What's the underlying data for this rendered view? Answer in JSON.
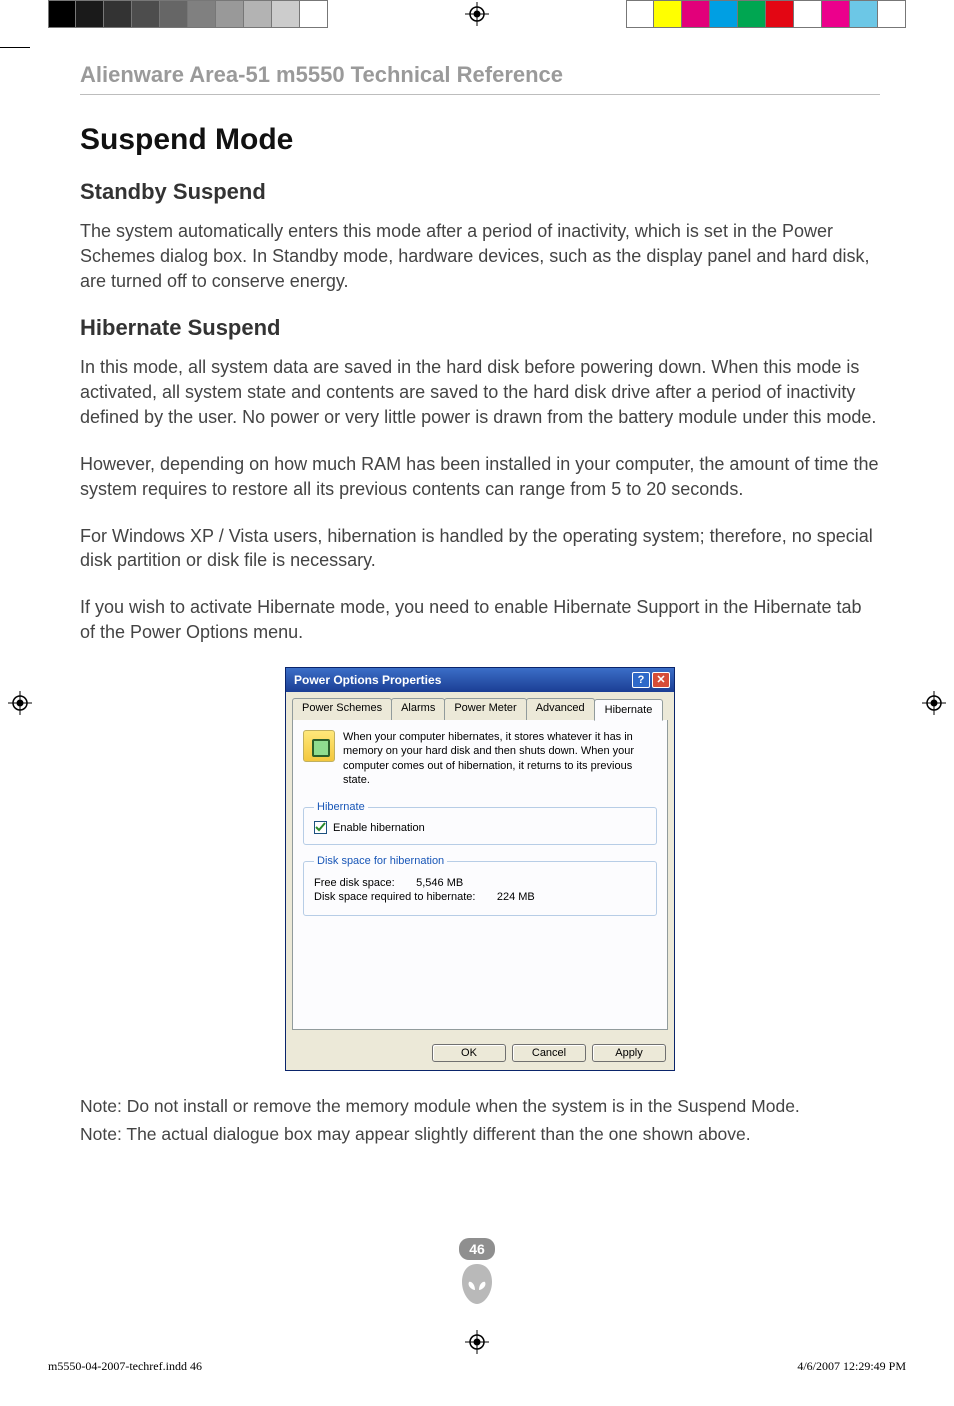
{
  "printer_marks": {
    "left_swatches": [
      "#000000",
      "#1a1a1a",
      "#333333",
      "#4d4d4d",
      "#666666",
      "#808080",
      "#999999",
      "#b3b3b3",
      "#cccccc",
      "#ffffff"
    ],
    "right_swatches": [
      "#ffffff",
      "#ffff00",
      "#e2007a",
      "#009fe3",
      "#00a651",
      "#e30613",
      "#ffffff",
      "#ec008c",
      "#6cc7e6",
      "#ffffff"
    ]
  },
  "header": {
    "running": "Alienware Area-51 m5550 Technical Reference"
  },
  "section": {
    "title": "Suspend Mode",
    "standby": {
      "heading": "Standby Suspend",
      "p1": "The system automatically enters this mode after a period of inactivity, which is set in the Power Schemes dialog box. In Standby mode, hardware devices, such as the display panel and hard disk, are turned off to conserve energy."
    },
    "hibernate": {
      "heading": "Hibernate Suspend",
      "p1": "In this mode, all system data are saved in the hard disk before powering down. When this mode is activated, all system state and contents are saved to the hard disk drive after a period of inactivity defined by the user. No power or very little power is drawn from the battery module under this mode.",
      "p2": "However, depending on how much RAM has been installed in your computer, the amount of time the system requires to restore all its previous contents can range from 5 to 20 seconds.",
      "p3": "For Windows XP / Vista users, hibernation is handled by the operating system; therefore, no special disk partition or disk file is necessary.",
      "p4": "If you wish to activate Hibernate mode, you need to enable Hibernate Support in the Hibernate tab of the Power Options menu."
    },
    "notes": {
      "n1": "Note: Do not install or remove the memory module when the system is in the Suspend Mode.",
      "n2": "Note: The actual dialogue box may appear slightly different than the one shown above."
    }
  },
  "dialog": {
    "title": "Power Options Properties",
    "tabs": [
      "Power Schemes",
      "Alarms",
      "Power Meter",
      "Advanced",
      "Hibernate"
    ],
    "active_tab": "Hibernate",
    "desc": "When your computer hibernates, it stores whatever it has in memory on your hard disk and then shuts down. When your computer comes out of hibernation, it returns to its previous state.",
    "group_hibernate": {
      "legend": "Hibernate",
      "checkbox_label": "Enable hibernation",
      "checked": true
    },
    "group_disk": {
      "legend": "Disk space for hibernation",
      "free_label": "Free disk space:",
      "free_value": "5,546 MB",
      "req_label": "Disk space required to hibernate:",
      "req_value": "224 MB"
    },
    "buttons": {
      "ok": "OK",
      "cancel": "Cancel",
      "apply": "Apply"
    }
  },
  "footer": {
    "page_number": "46",
    "slug_left": "m5550-04-2007-techref.indd   46",
    "slug_right": "4/6/2007   12:29:49 PM"
  }
}
